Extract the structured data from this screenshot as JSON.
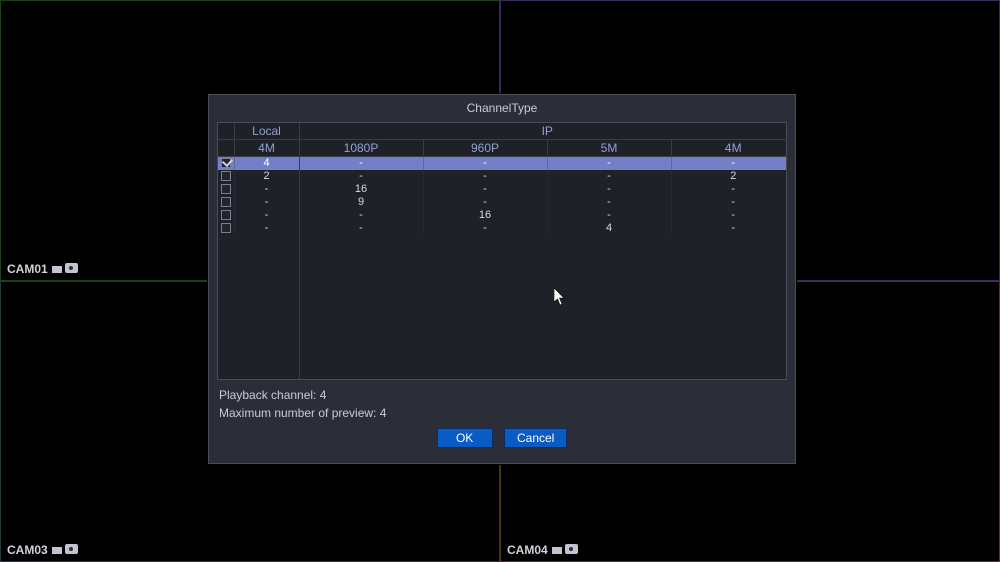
{
  "cams": {
    "c1": "CAM01",
    "c3": "CAM03",
    "c4": "CAM04"
  },
  "dialog": {
    "title": "ChannelType",
    "group_local": "Local",
    "group_ip": "IP",
    "cols": {
      "c0": "4M",
      "c1": "1080P",
      "c2": "960P",
      "c3": "5M",
      "c4": "4M"
    },
    "rows": [
      {
        "checked": true,
        "v0": "4",
        "v1": "-",
        "v2": "-",
        "v3": "-",
        "v4": "-"
      },
      {
        "checked": false,
        "v0": "2",
        "v1": "-",
        "v2": "-",
        "v3": "-",
        "v4": "2"
      },
      {
        "checked": false,
        "v0": "-",
        "v1": "16",
        "v2": "-",
        "v3": "-",
        "v4": "-"
      },
      {
        "checked": false,
        "v0": "-",
        "v1": "9",
        "v2": "-",
        "v3": "-",
        "v4": "-"
      },
      {
        "checked": false,
        "v0": "-",
        "v1": "-",
        "v2": "16",
        "v3": "-",
        "v4": "-"
      },
      {
        "checked": false,
        "v0": "-",
        "v1": "-",
        "v2": "-",
        "v3": "4",
        "v4": "-"
      }
    ],
    "playback_label": "Playback channel: 4",
    "maxpreview_label": "Maximum number of preview: 4",
    "ok_label": "OK",
    "cancel_label": "Cancel"
  }
}
